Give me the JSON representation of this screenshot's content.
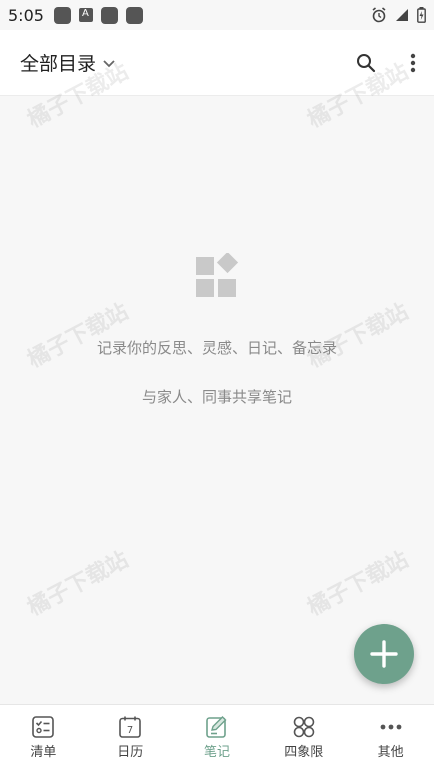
{
  "status_bar": {
    "time": "5:05"
  },
  "header": {
    "title": "全部目录"
  },
  "empty_state": {
    "line1": "记录你的反思、灵感、日记、备忘录",
    "line2": "与家人、同事共享笔记"
  },
  "watermark": {
    "text": "橘子下载站"
  },
  "tabs": [
    {
      "label": "清单",
      "icon": "checklist-icon"
    },
    {
      "label": "日历",
      "icon": "calendar-icon",
      "day": "7"
    },
    {
      "label": "笔记",
      "icon": "note-icon",
      "active": true
    },
    {
      "label": "四象限",
      "icon": "quadrant-icon"
    },
    {
      "label": "其他",
      "icon": "more-icon"
    }
  ],
  "colors": {
    "accent": "#6ea18c",
    "icon_gray": "#c9c9c9"
  }
}
